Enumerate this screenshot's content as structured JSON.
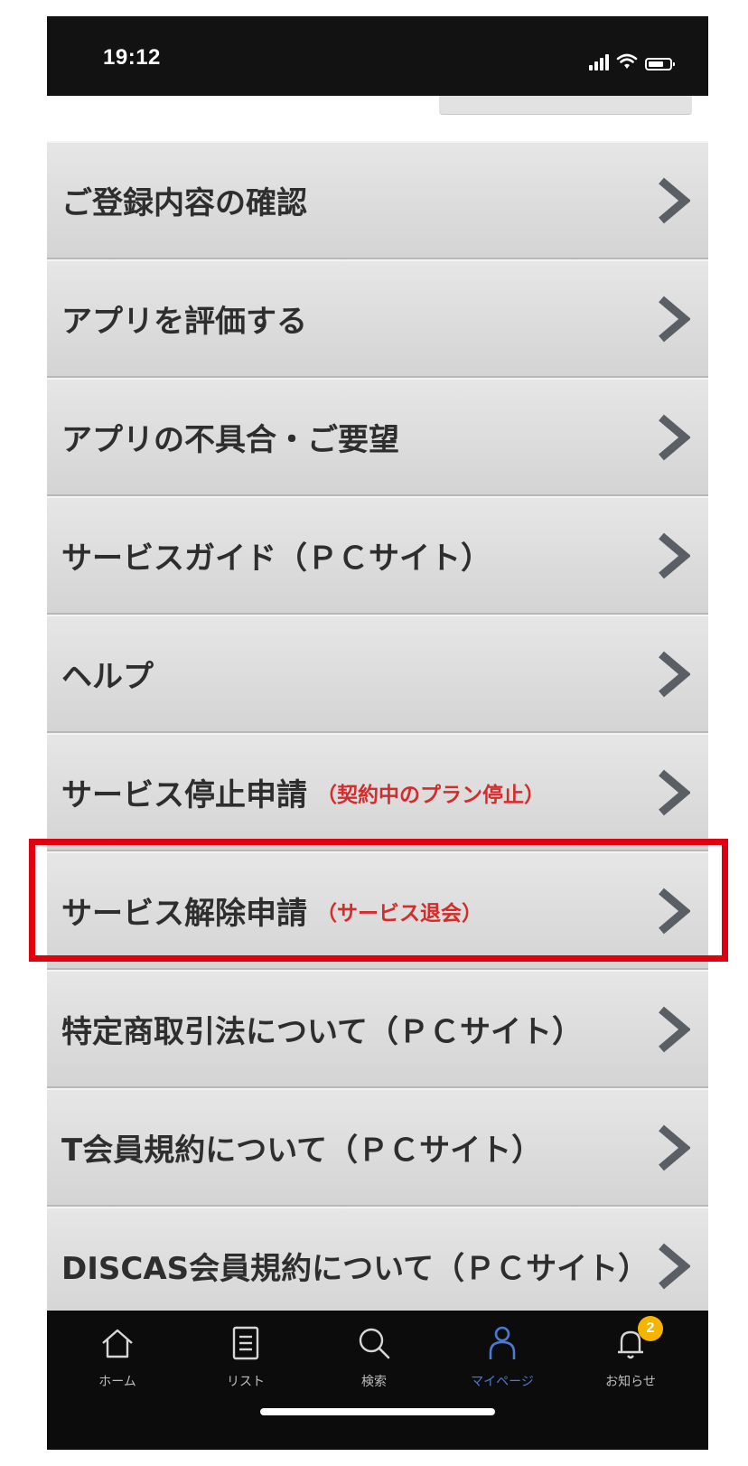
{
  "status_bar": {
    "time": "19:12"
  },
  "menu": {
    "items": [
      {
        "label": "ご登録内容の確認",
        "note": ""
      },
      {
        "label": "アプリを評価する",
        "note": ""
      },
      {
        "label": "アプリの不具合・ご要望",
        "note": ""
      },
      {
        "label": "サービスガイド（ＰＣサイト）",
        "note": ""
      },
      {
        "label": "ヘルプ",
        "note": ""
      },
      {
        "label": "サービス停止申請",
        "note": "（契約中のプラン停止）"
      },
      {
        "label": "サービス解除申請",
        "note": "（サービス退会）"
      },
      {
        "label": "特定商取引法について（ＰＣサイト）",
        "note": ""
      },
      {
        "label": "T会員規約について（ＰＣサイト）",
        "note": ""
      },
      {
        "label": "DISCAS会員規約について（ＰＣサイト）",
        "note": ""
      }
    ]
  },
  "tab_bar": {
    "items": [
      {
        "label": "ホーム",
        "icon": "home-icon"
      },
      {
        "label": "リスト",
        "icon": "list-icon"
      },
      {
        "label": "検索",
        "icon": "search-icon"
      },
      {
        "label": "マイページ",
        "icon": "person-icon"
      },
      {
        "label": "お知らせ",
        "icon": "bell-icon"
      }
    ],
    "notification_badge": "2",
    "active_color": "#4a7bd0"
  },
  "colors": {
    "highlight": "#e0000f",
    "note_red": "#d62b2b"
  }
}
